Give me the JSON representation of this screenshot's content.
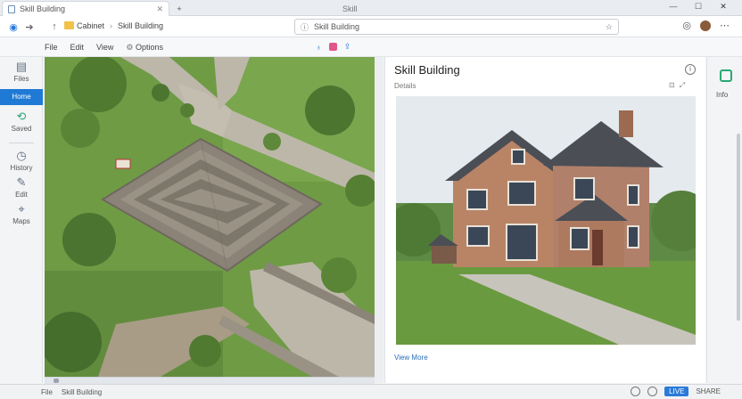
{
  "tabs": {
    "active_title": "Skill Building",
    "new_tab_glyph": "+",
    "secondary_title": "Skill"
  },
  "toolbar": {
    "path_segments": [
      "Cabinet",
      "Skill Building"
    ],
    "address_text": "Skill Building"
  },
  "menu": {
    "items": [
      "File",
      "Edit",
      "View",
      "Options"
    ]
  },
  "sidebar": {
    "items": [
      {
        "label": "Files",
        "icon": "document-icon"
      },
      {
        "label": "Home",
        "icon": "home-icon"
      },
      {
        "label": "Saved",
        "icon": "refresh-icon"
      },
      {
        "label": "History",
        "icon": "clock-icon"
      },
      {
        "label": "Edit",
        "icon": "pencil-icon"
      },
      {
        "label": "Maps",
        "icon": "pin-icon"
      }
    ]
  },
  "panel": {
    "title": "Skill Building",
    "meta": "Details",
    "link_text": "View More"
  },
  "rail": {
    "label": "Info"
  },
  "status": {
    "left": [
      "File",
      "Skill Building"
    ],
    "pill": "LIVE",
    "right_text": "SHARE"
  },
  "colors": {
    "accent": "#1f7ad6",
    "grass": "#6e9a46",
    "path": "#bfb9ad",
    "stone": "#8c8478",
    "brick": "#b98466",
    "roof": "#4b4e55"
  }
}
